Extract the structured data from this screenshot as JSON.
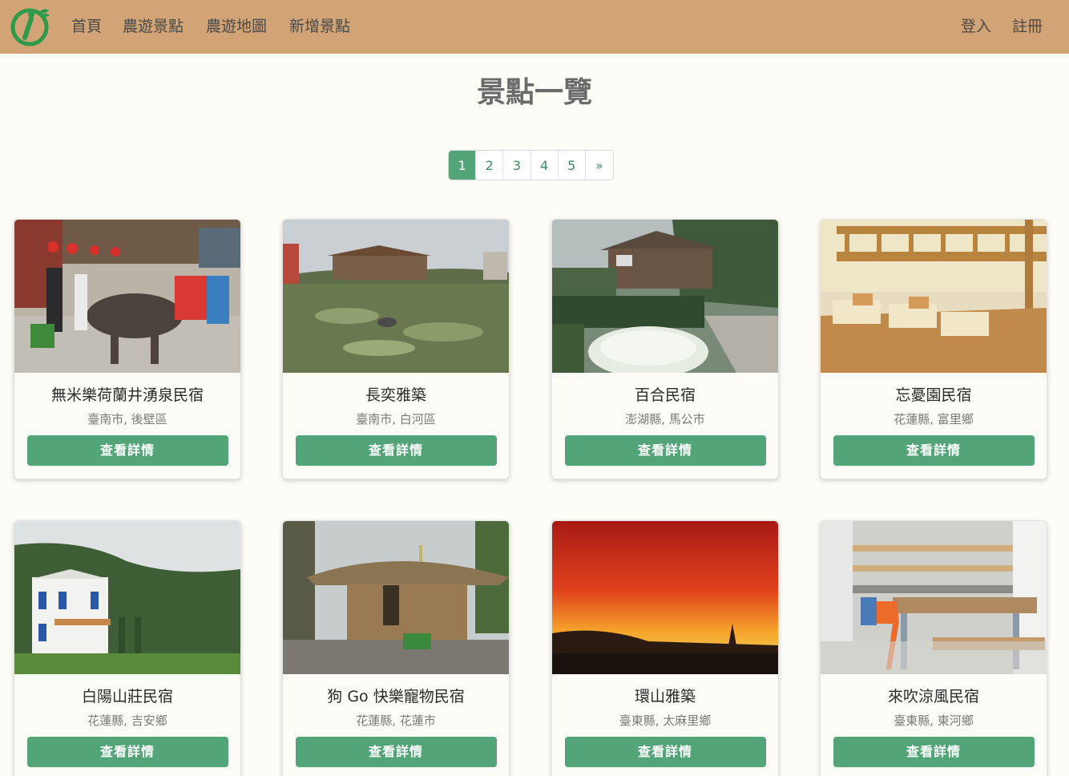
{
  "nav": {
    "logo": "logo-icon",
    "links": [
      "首頁",
      "農遊景點",
      "農遊地圖",
      "新增景點"
    ],
    "auth": [
      "登入",
      "註冊"
    ]
  },
  "page_title": "景點一覽",
  "pagination": {
    "pages": [
      "1",
      "2",
      "3",
      "4",
      "5"
    ],
    "next": "»",
    "active": "1"
  },
  "cards": [
    {
      "title": "無米樂荷蘭井湧泉民宿",
      "location": "臺南市, 後壁區",
      "button": "查看詳情"
    },
    {
      "title": "長奕雅築",
      "location": "臺南市, 白河區",
      "button": "查看詳情"
    },
    {
      "title": "百合民宿",
      "location": "澎湖縣, 馬公市",
      "button": "查看詳情"
    },
    {
      "title": "忘憂園民宿",
      "location": "花蓮縣, 富里鄉",
      "button": "查看詳情"
    },
    {
      "title": "白陽山莊民宿",
      "location": "花蓮縣, 吉安鄉",
      "button": "查看詳情"
    },
    {
      "title": "狗 Go 快樂寵物民宿",
      "location": "花蓮縣, 花蓮市",
      "button": "查看詳情"
    },
    {
      "title": "環山雅築",
      "location": "臺東縣, 太麻里鄉",
      "button": "查看詳情"
    },
    {
      "title": "來吹涼風民宿",
      "location": "臺東縣, 東河鄉",
      "button": "查看詳情"
    }
  ],
  "colors": {
    "navbar": "#d2a374",
    "accent_green": "#53a478",
    "background": "#fdfcf6"
  }
}
